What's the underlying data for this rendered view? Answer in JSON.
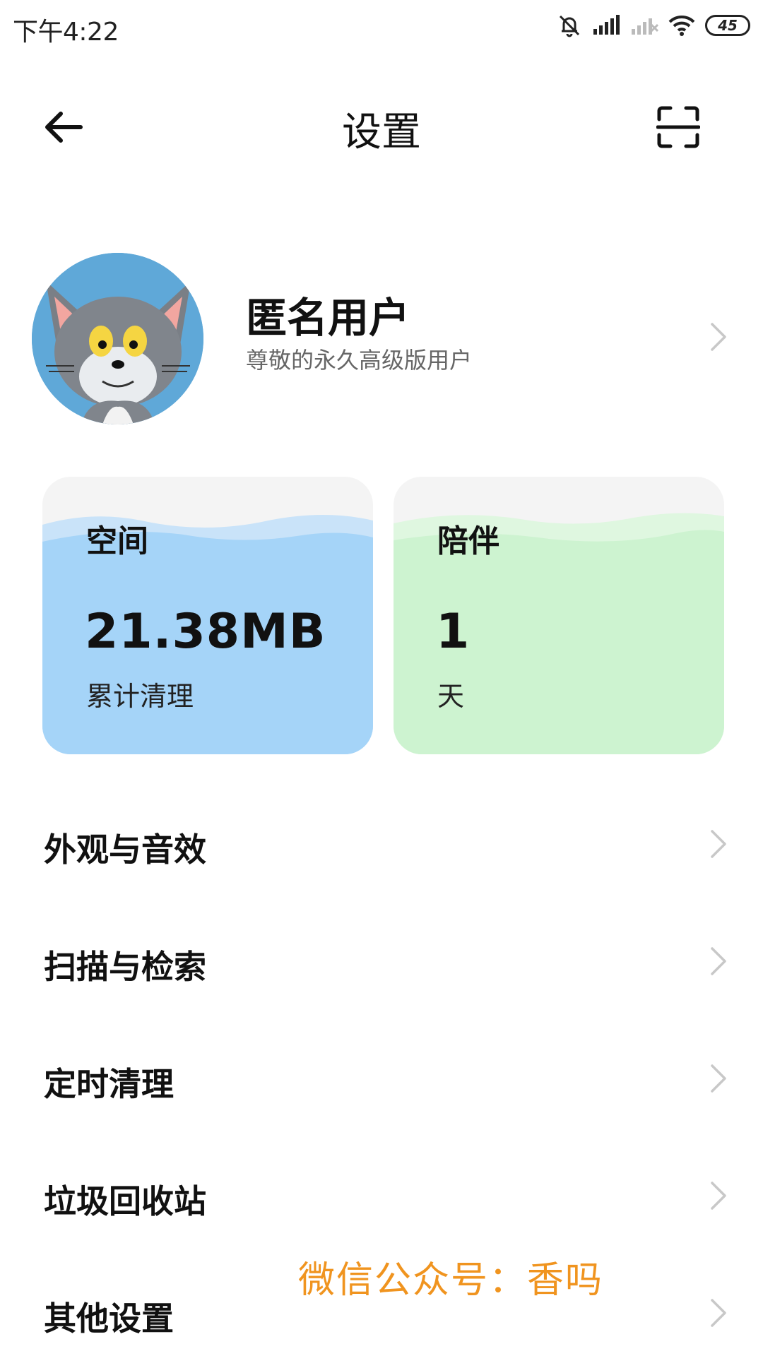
{
  "status_bar": {
    "time": "下午4:22",
    "battery": "45",
    "icons": [
      "mute-icon",
      "signal-icon",
      "signal-empty-icon",
      "wifi-icon",
      "battery-icon"
    ]
  },
  "header": {
    "title": "设置",
    "back_icon": "arrow-left-icon",
    "scan_icon": "scan-icon"
  },
  "profile": {
    "name": "匿名用户",
    "subtitle": "尊敬的永久高级版用户",
    "avatar": "cartoon-cat-avatar"
  },
  "cards": [
    {
      "label": "空间",
      "value": "21.38MB",
      "unit": "累计清理",
      "color": "#a5d4f8"
    },
    {
      "label": "陪伴",
      "value": "1",
      "unit": "天",
      "color": "#cdf3d0"
    }
  ],
  "menu": {
    "items": [
      {
        "label": "外观与音效"
      },
      {
        "label": "扫描与检索"
      },
      {
        "label": "定时清理"
      },
      {
        "label": "垃圾回收站"
      },
      {
        "label": "其他设置"
      }
    ]
  },
  "watermark": "微信公众号：香吗"
}
